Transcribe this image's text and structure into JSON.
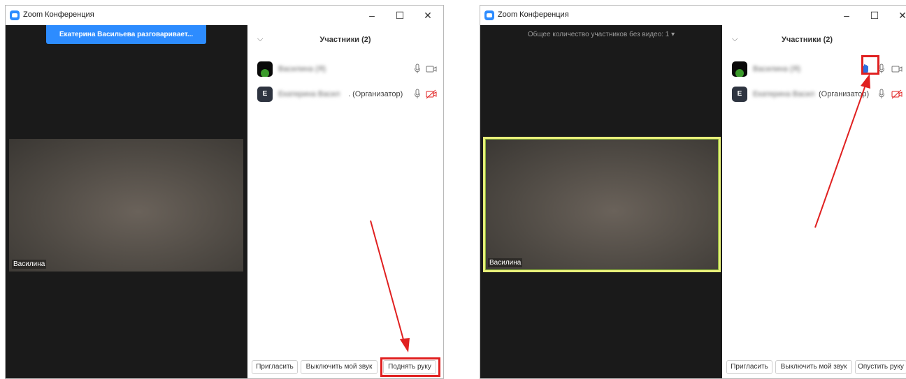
{
  "left_window": {
    "title": "Zoom Конференция",
    "speaker_banner": "Екатерина Васильева разговаривает...",
    "video_name": "Василина",
    "panel_title": "Участники (2)",
    "participants": [
      {
        "avatar": "",
        "name": "Василина (Я)",
        "role": ""
      },
      {
        "avatar": "E",
        "name": "Екатерина Васил",
        "role": ". (Организатор)"
      }
    ],
    "buttons": {
      "invite": "Пригласить",
      "mute_me": "Выключить мой звук",
      "raise_hand": "Поднять руку"
    }
  },
  "right_window": {
    "title": "Zoom Конференция",
    "no_video_count": "Общее количество участников без видео: 1",
    "video_name": "Василина",
    "panel_title": "Участники (2)",
    "participants": [
      {
        "avatar": "",
        "name": "Василина (Я)",
        "role": ""
      },
      {
        "avatar": "E",
        "name": "Екатерина Васил",
        "role": "(Организатор)"
      }
    ],
    "buttons": {
      "invite": "Пригласить",
      "mute_me": "Выключить мой звук",
      "lower_hand": "Опустить руку"
    }
  },
  "colors": {
    "accent": "#2d8cff",
    "video_bg": "#1a1a1a",
    "highlight": "#e02020",
    "active_border": "#e8f07a",
    "muted_video": "#e02020"
  }
}
